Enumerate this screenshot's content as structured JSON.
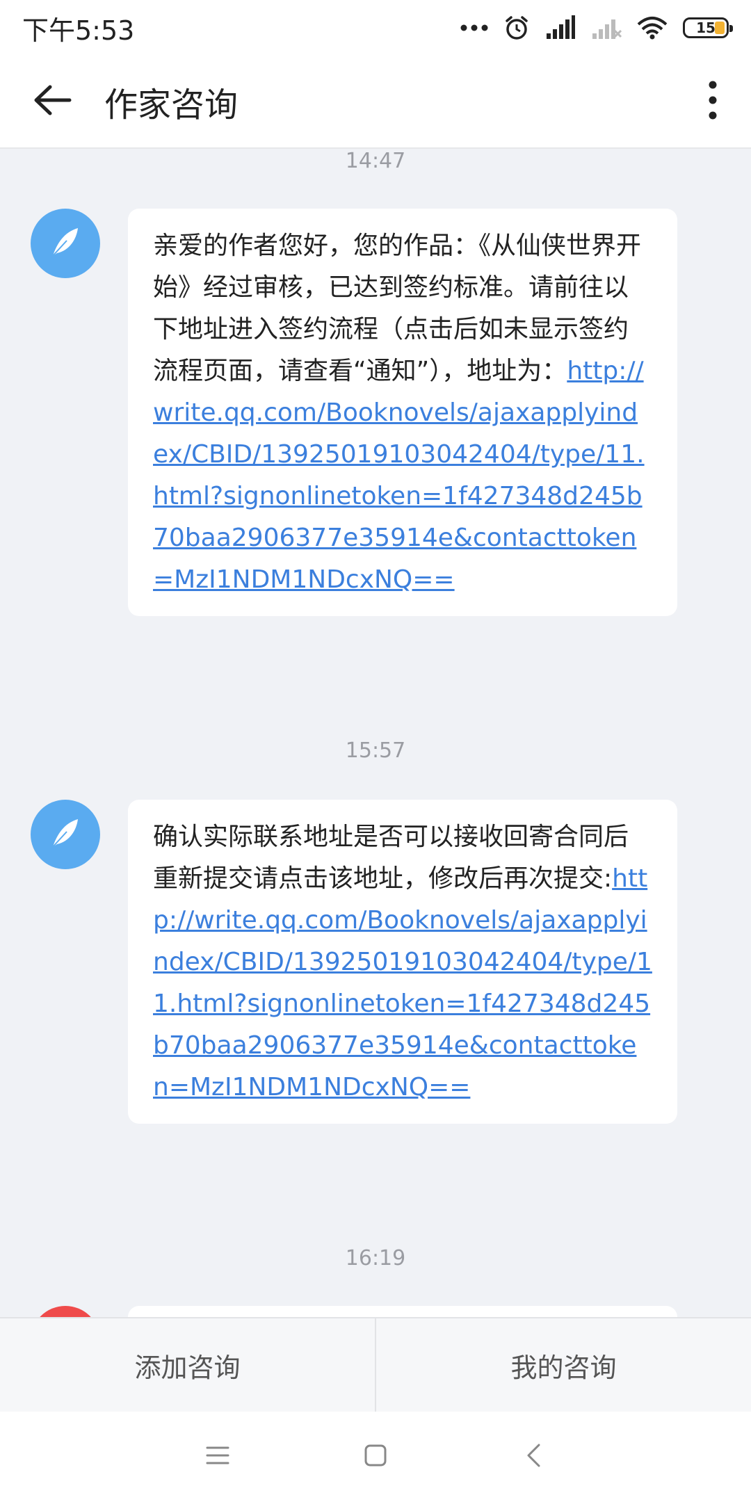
{
  "status_bar": {
    "time": "下午5:53",
    "battery": "15",
    "icons": [
      "more-dots-icon",
      "alarm-icon",
      "signal-icon",
      "signal-no-service-icon",
      "wifi-icon",
      "battery-icon"
    ]
  },
  "app_bar": {
    "title": "作家咨询",
    "back_icon": "arrow-left-icon",
    "more_icon": "more-vertical-icon"
  },
  "messages": [
    {
      "time": "14:47",
      "text": "亲爱的作者您好，您的作品：《从仙侠世界开始》经过审核，已达到签约标准。请前往以下地址进入签约流程（点击后如未显示签约流程页面，请查看“通知”），地址为：",
      "link": "http://write.qq.com/Booknovels/ajaxapplyindex/CBID/13925019103042404/type/11.html?signonlinetoken=1f427348d245b70baa2906377e35914e&contacttoken=MzI1NDM1NDcxNQ=="
    },
    {
      "time": "15:57",
      "text": "确认实际联系地址是否可以接收回寄合同后重新提交请点击该地址，修改后再次提交:",
      "link": "http://write.qq.com/Booknovels/ajaxapplyindex/CBID/13925019103042404/type/11.html?signonlinetoken=1f427348d245b70baa2906377e35914e&contacttoken=MzI1NDM1NDcxNQ=="
    },
    {
      "time": "16:19"
    }
  ],
  "bottom_bar": {
    "add_label": "添加咨询",
    "mine_label": "我的咨询"
  },
  "colors": {
    "accent_blue": "#5aabf0",
    "link": "#3b7fdd",
    "background": "#f0f2f6"
  }
}
